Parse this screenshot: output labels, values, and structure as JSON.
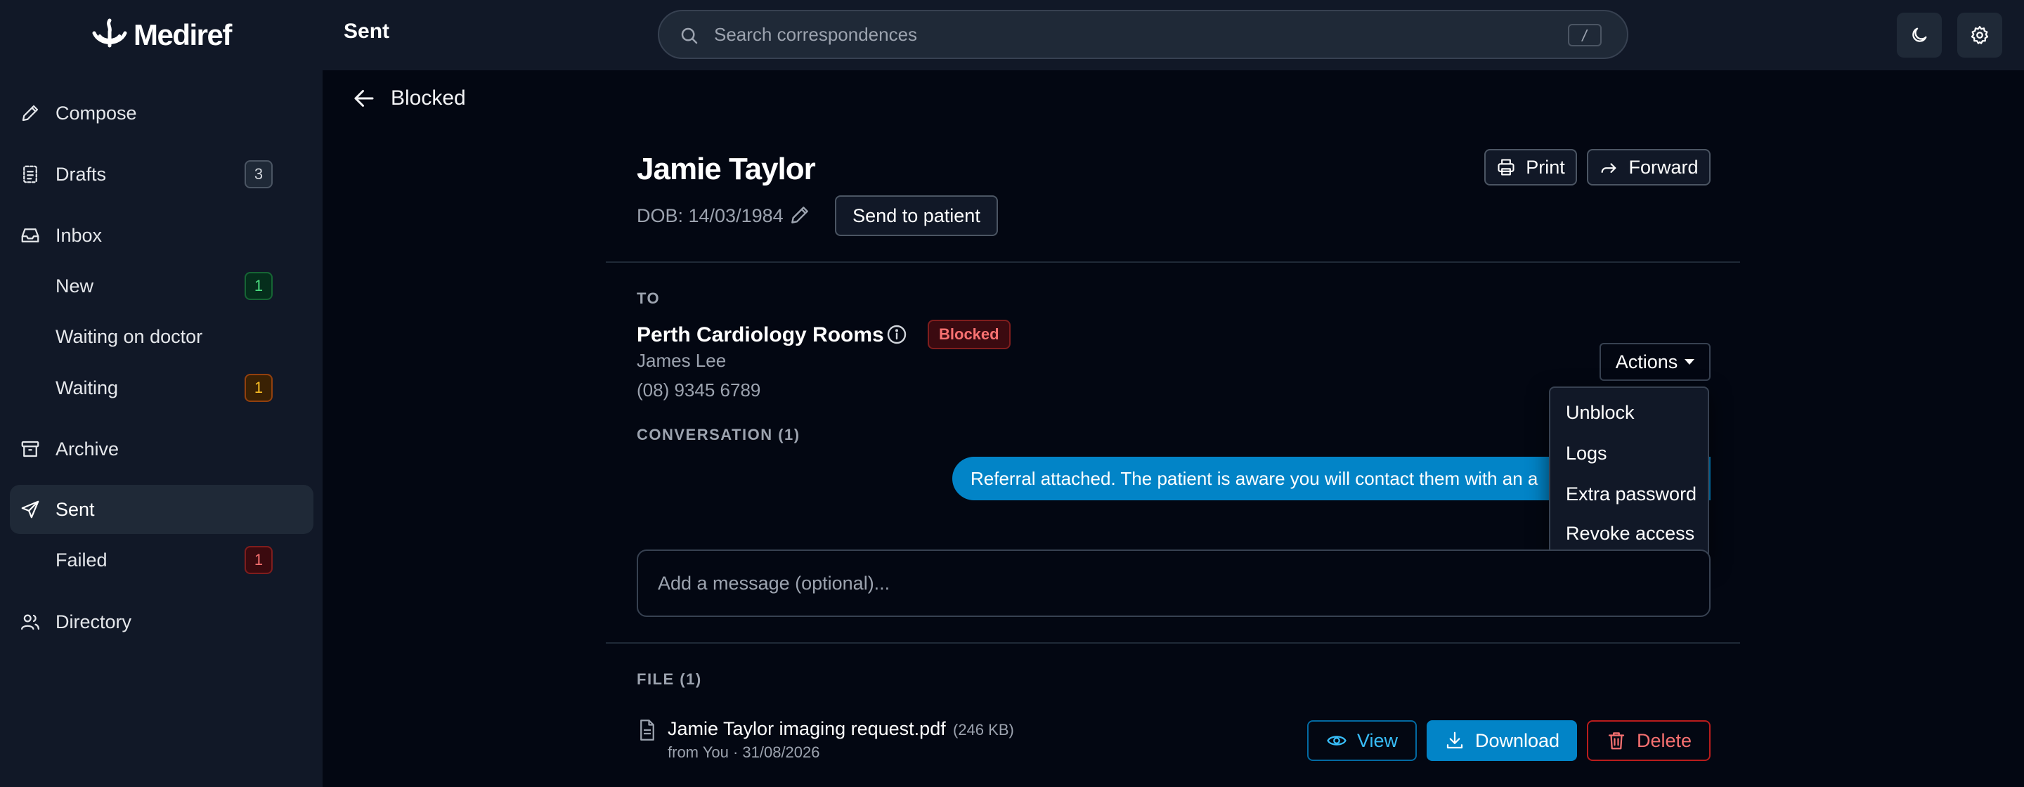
{
  "app": {
    "name": "Mediref",
    "logo_icon": "mediref-logo-icon"
  },
  "sidebar": {
    "items": [
      {
        "label": "Compose",
        "icon": "pencil-icon"
      },
      {
        "label": "Drafts",
        "icon": "drafts-icon",
        "badge": "3"
      },
      {
        "label": "Inbox",
        "icon": "inbox-icon"
      },
      {
        "label": "New",
        "badge": "1"
      },
      {
        "label": "Waiting on doctor"
      },
      {
        "label": "Waiting",
        "badge": "1"
      },
      {
        "label": "Archive",
        "icon": "archive-icon"
      },
      {
        "label": "Sent",
        "icon": "send-icon",
        "active": true
      },
      {
        "label": "Failed",
        "badge": "1"
      },
      {
        "label": "Directory",
        "icon": "users-icon"
      }
    ]
  },
  "header": {
    "title": "Sent",
    "search": {
      "placeholder": "Search correspondences",
      "shortcut": "/"
    },
    "theme_icon": "moon-icon",
    "settings_icon": "gear-icon"
  },
  "page": {
    "back_label": "Blocked",
    "patient": {
      "name": "Jamie Taylor",
      "dob": "DOB: 14/03/1984"
    },
    "send_to_patient_label": "Send to patient",
    "print_label": "Print",
    "forward_label": "Forward",
    "to": {
      "section_label": "TO",
      "recipient": "Perth Cardiology Rooms",
      "status_badge": "Blocked",
      "contact_name": "James Lee",
      "phone": "(08) 9345 6789"
    },
    "actions": {
      "label": "Actions",
      "menu": [
        "Unblock",
        "Logs",
        "Extra password",
        "Revoke access"
      ]
    },
    "conversation": {
      "section_label": "CONVERSATION (1)",
      "message": "Referral attached. The patient is aware you will contact them with an a"
    },
    "compose": {
      "placeholder": "Add a message (optional)..."
    },
    "files": {
      "section_label": "FILE (1)",
      "items": [
        {
          "name": "Jamie Taylor imaging request.pdf",
          "size": "(246 KB)",
          "from": "from You · 31/08/2026"
        }
      ],
      "view_label": "View",
      "download_label": "Download",
      "delete_label": "Delete"
    }
  },
  "colors": {
    "background": "#030712",
    "sidebar": "#111827",
    "accent": "#0284c7",
    "danger": "#f87171"
  }
}
